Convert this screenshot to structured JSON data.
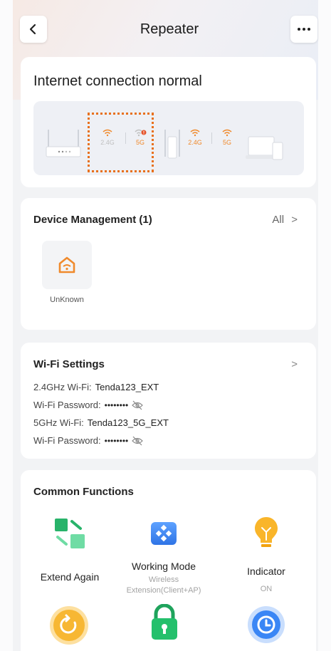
{
  "header": {
    "title": "Repeater"
  },
  "status": {
    "title": "Internet connection normal",
    "topology": {
      "left_bands": [
        "2.4G",
        "5G"
      ],
      "right_bands": [
        "2.4G",
        "5G"
      ]
    }
  },
  "devices": {
    "title": "Device Management (1)",
    "all_label": "All",
    "items": [
      {
        "name": "UnKnown"
      }
    ]
  },
  "wifi": {
    "title": "Wi-Fi Settings",
    "rows": [
      {
        "label": "2.4GHz Wi-Fi:",
        "value": "Tenda123_EXT"
      },
      {
        "label": "Wi-Fi Password:",
        "value": "••••••••"
      },
      {
        "label": "5GHz Wi-Fi:",
        "value": "Tenda123_5G_EXT"
      },
      {
        "label": "Wi-Fi Password:",
        "value": "••••••••"
      }
    ]
  },
  "functions": {
    "title": "Common Functions",
    "items": [
      {
        "name": "Extend Again",
        "sub": ""
      },
      {
        "name": "Working Mode",
        "sub": "Wireless Extension(Client+AP)"
      },
      {
        "name": "Indicator",
        "sub": "ON"
      }
    ]
  },
  "colors": {
    "accent": "#f08a2c",
    "green": "#2cc27a",
    "blue": "#3a86f5",
    "yellow": "#f9b52a"
  }
}
